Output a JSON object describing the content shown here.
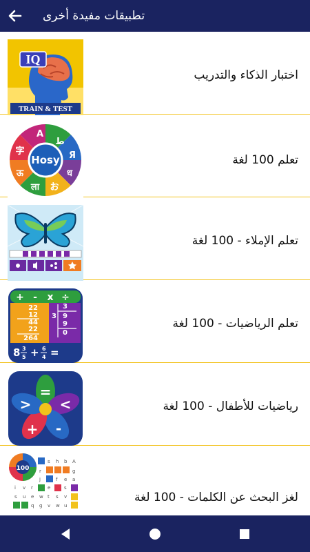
{
  "header": {
    "title": "تطبيقات مفيدة أخرى",
    "back_icon": "arrow-left-icon"
  },
  "apps": [
    {
      "label": "اختبار الذكاء والتدريب",
      "icon_text_top": "IQ",
      "icon_text_bottom": "TRAIN & TEST"
    },
    {
      "label": "تعلم 100 لغة",
      "icon_text": "Hosy",
      "letters": [
        "A",
        "ط",
        "Я",
        "ध",
        "お",
        "ला",
        "ऊ",
        "字"
      ]
    },
    {
      "label": "تعلم الإملاء - 100 لغة"
    },
    {
      "label": "تعلم الرياضيات - 100 لغة",
      "ops": [
        "+",
        "-",
        "x",
        "÷"
      ],
      "sum": [
        "22",
        "12",
        "44",
        "22",
        "264"
      ],
      "div": [
        "3",
        "3",
        "9",
        "9",
        "0"
      ],
      "fraction": [
        "8",
        "3",
        "5",
        "+",
        "6",
        "4",
        "="
      ]
    },
    {
      "label": "رياضيات للأطفال - 100 لغة",
      "symbols": [
        "=",
        "<",
        "-",
        "+",
        ">"
      ]
    },
    {
      "label": "لغز البحث عن الكلمات - 100 لغة",
      "badge": "100"
    }
  ],
  "nav": {
    "back": "nav-back-icon",
    "home": "nav-home-icon",
    "recents": "nav-recents-icon"
  },
  "colors": {
    "bar": "#1a2360",
    "divider": "#f2c21b"
  }
}
